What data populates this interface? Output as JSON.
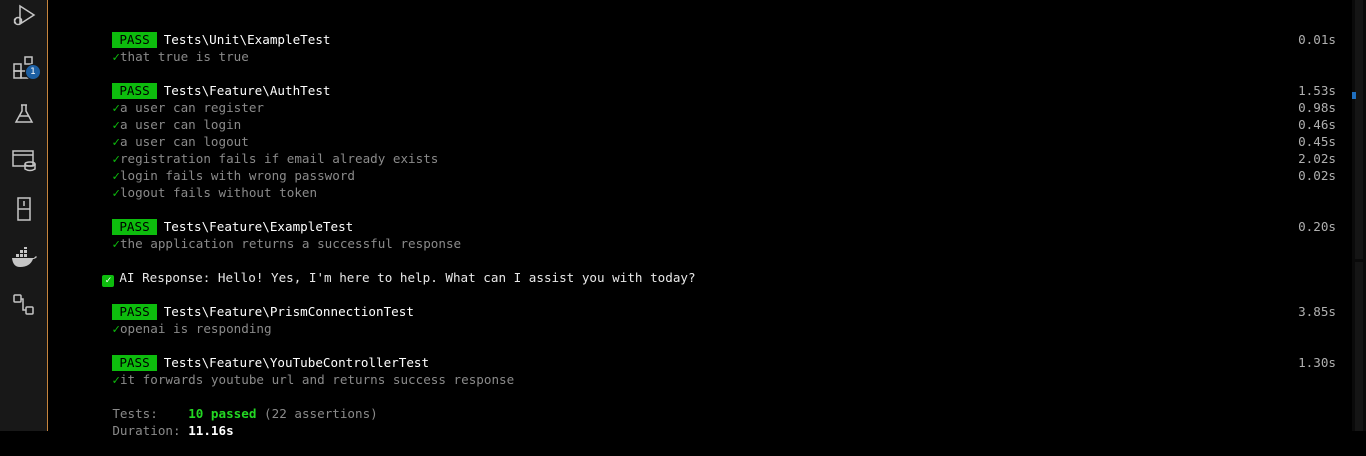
{
  "activity_bar": {
    "items": [
      {
        "name": "run-debug-icon"
      },
      {
        "name": "extensions-icon",
        "badge": "1"
      },
      {
        "name": "testing-icon"
      },
      {
        "name": "remote-explorer-icon"
      },
      {
        "name": "database-icon"
      },
      {
        "name": "docker-icon"
      },
      {
        "name": "source-graph-icon"
      }
    ],
    "border_color": "#c6843c"
  },
  "terminal": {
    "pass_label": "PASS",
    "check_glyph": "✓",
    "suites": [
      {
        "name": "Tests\\Unit\\ExampleTest",
        "tests": [
          {
            "name": "that true is true",
            "duration": "0.01s"
          }
        ]
      },
      {
        "name": "Tests\\Feature\\AuthTest",
        "tests": [
          {
            "name": "a user can register",
            "duration": "1.53s"
          },
          {
            "name": "a user can login",
            "duration": "0.98s"
          },
          {
            "name": "a user can logout",
            "duration": "0.46s"
          },
          {
            "name": "registration fails if email already exists",
            "duration": "0.45s"
          },
          {
            "name": "login fails with wrong password",
            "duration": "2.02s"
          },
          {
            "name": "logout fails without token",
            "duration": "0.02s"
          }
        ]
      },
      {
        "name": "Tests\\Feature\\ExampleTest",
        "tests": [
          {
            "name": "the application returns a successful response",
            "duration": "0.20s"
          }
        ]
      },
      {
        "name": "Tests\\Feature\\PrismConnectionTest",
        "tests": [
          {
            "name": "openai is responding",
            "duration": "3.85s"
          }
        ]
      },
      {
        "name": "Tests\\Feature\\YouTubeControllerTest",
        "tests": [
          {
            "name": "it forwards youtube url and returns success response",
            "duration": "1.30s"
          }
        ]
      }
    ],
    "ai_response": {
      "icon_glyph": "✓",
      "text": "AI Response: Hello! Yes, I'm here to help. What can I assist you with today?"
    },
    "summary": {
      "tests_label": "Tests:",
      "passed": "10 passed",
      "assertions": "(22 assertions)",
      "duration_label": "Duration:",
      "duration": "11.16s"
    }
  },
  "colors": {
    "pass_bg": "#0dbc0d",
    "check": "#0dbc0d",
    "background": "#000000"
  }
}
